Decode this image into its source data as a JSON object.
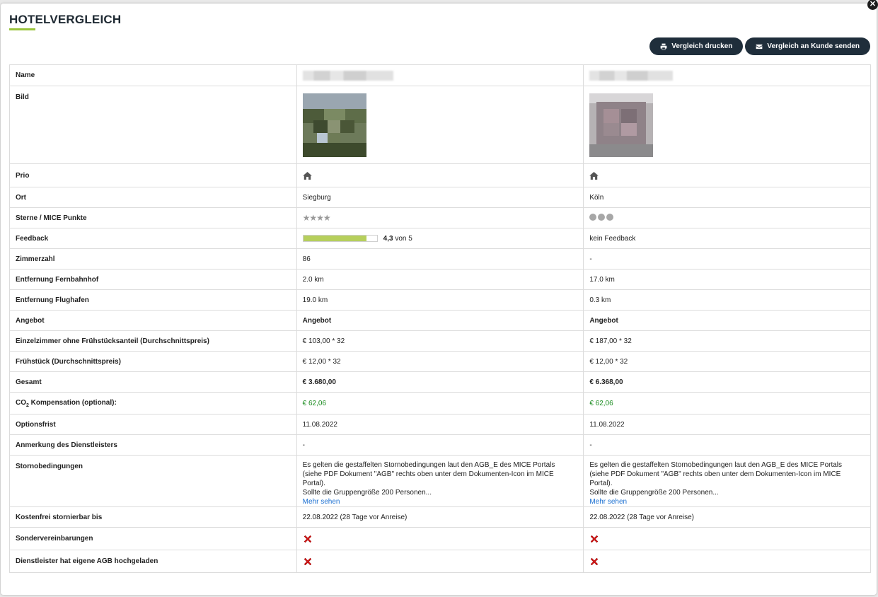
{
  "title": "HOTELVERGLEICH",
  "buttons": {
    "print": "Vergleich drucken",
    "send": "Vergleich an Kunde senden"
  },
  "colors": {
    "accent_green": "#9ac43c",
    "button_dark": "#1f2e3b",
    "co2_green": "#178a1c",
    "gesamt_blue": "#5a7494",
    "link_blue": "#1a6fd1",
    "cross_red": "#d21a1a"
  },
  "labels": {
    "name": "Name",
    "bild": "Bild",
    "prio": "Prio",
    "ort": "Ort",
    "sterne": "Sterne / MICE Punkte",
    "feedback": "Feedback",
    "zimmer": "Zimmerzahl",
    "fernbahnhof": "Entfernung Fernbahnhof",
    "flughafen": "Entfernung Flughafen",
    "angebot": "Angebot",
    "ez": "Einzelzimmer ohne Frühstücksanteil (Durchschnittspreis)",
    "fruehstueck": "Frühstück (Durchschnittspreis)",
    "gesamt": "Gesamt",
    "co2_prefix": "CO",
    "co2_sub": "2",
    "co2_suffix": " Kompensation (optional):",
    "optionsfrist": "Optionsfrist",
    "anmerkung": "Anmerkung des Dienstleisters",
    "storno": "Stornobedingungen",
    "kostenfrei": "Kostenfrei stornierbar bis",
    "sonder": "Sondervereinbarungen",
    "agb": "Dienstleister hat eigene AGB hochgeladen"
  },
  "hotels": [
    {
      "prio_icon": "home-icon",
      "ort": "Siegburg",
      "sterne_display": "★★★★",
      "rating_type": "stars",
      "feedback_score": "4,3",
      "feedback_suffix": " von 5",
      "feedback_fraction": 0.86,
      "feedback_text": "",
      "zimmer": "86",
      "fernbahnhof": "2.0 km",
      "flughafen": "19.0 km",
      "angebot": "Angebot",
      "ez": "€ 103,00 * 32",
      "fruehstueck": "€ 12,00 * 32",
      "gesamt": "€ 3.680,00",
      "co2": "€ 62,06",
      "optionsfrist": "11.08.2022",
      "anmerkung": "-",
      "storno_lines": [
        "Es gelten die gestaffelten Stornobedingungen laut den AGB_E des MICE Portals",
        "(siehe PDF Dokument \"AGB\" rechts oben unter dem Dokumenten-Icon im MICE",
        "Portal).",
        "Sollte die Gruppengröße 200 Personen..."
      ],
      "mehr": "Mehr sehen",
      "kostenfrei": "22.08.2022 (28 Tage vor Anreise)",
      "sonder_icon": "cross-icon",
      "agb_icon": "cross-icon"
    },
    {
      "prio_icon": "home-icon",
      "ort": "Köln",
      "sterne_display": "",
      "rating_type": "dots",
      "rating_count": 3,
      "feedback_score": "",
      "feedback_suffix": "",
      "feedback_text": "kein Feedback",
      "zimmer": "-",
      "fernbahnhof": "17.0 km",
      "flughafen": "0.3 km",
      "angebot": "Angebot",
      "ez": "€ 187,00 * 32",
      "fruehstueck": "€ 12,00 * 32",
      "gesamt": "€ 6.368,00",
      "co2": "€ 62,06",
      "optionsfrist": "11.08.2022",
      "anmerkung": "-",
      "storno_lines": [
        "Es gelten die gestaffelten Stornobedingungen laut den AGB_E des MICE Portals",
        "(siehe PDF Dokument \"AGB\" rechts oben unter dem Dokumenten-Icon im MICE",
        "Portal).",
        "Sollte die Gruppengröße 200 Personen..."
      ],
      "mehr": "Mehr sehen",
      "kostenfrei": "22.08.2022 (28 Tage vor Anreise)",
      "sonder_icon": "cross-icon",
      "agb_icon": "cross-icon"
    }
  ]
}
